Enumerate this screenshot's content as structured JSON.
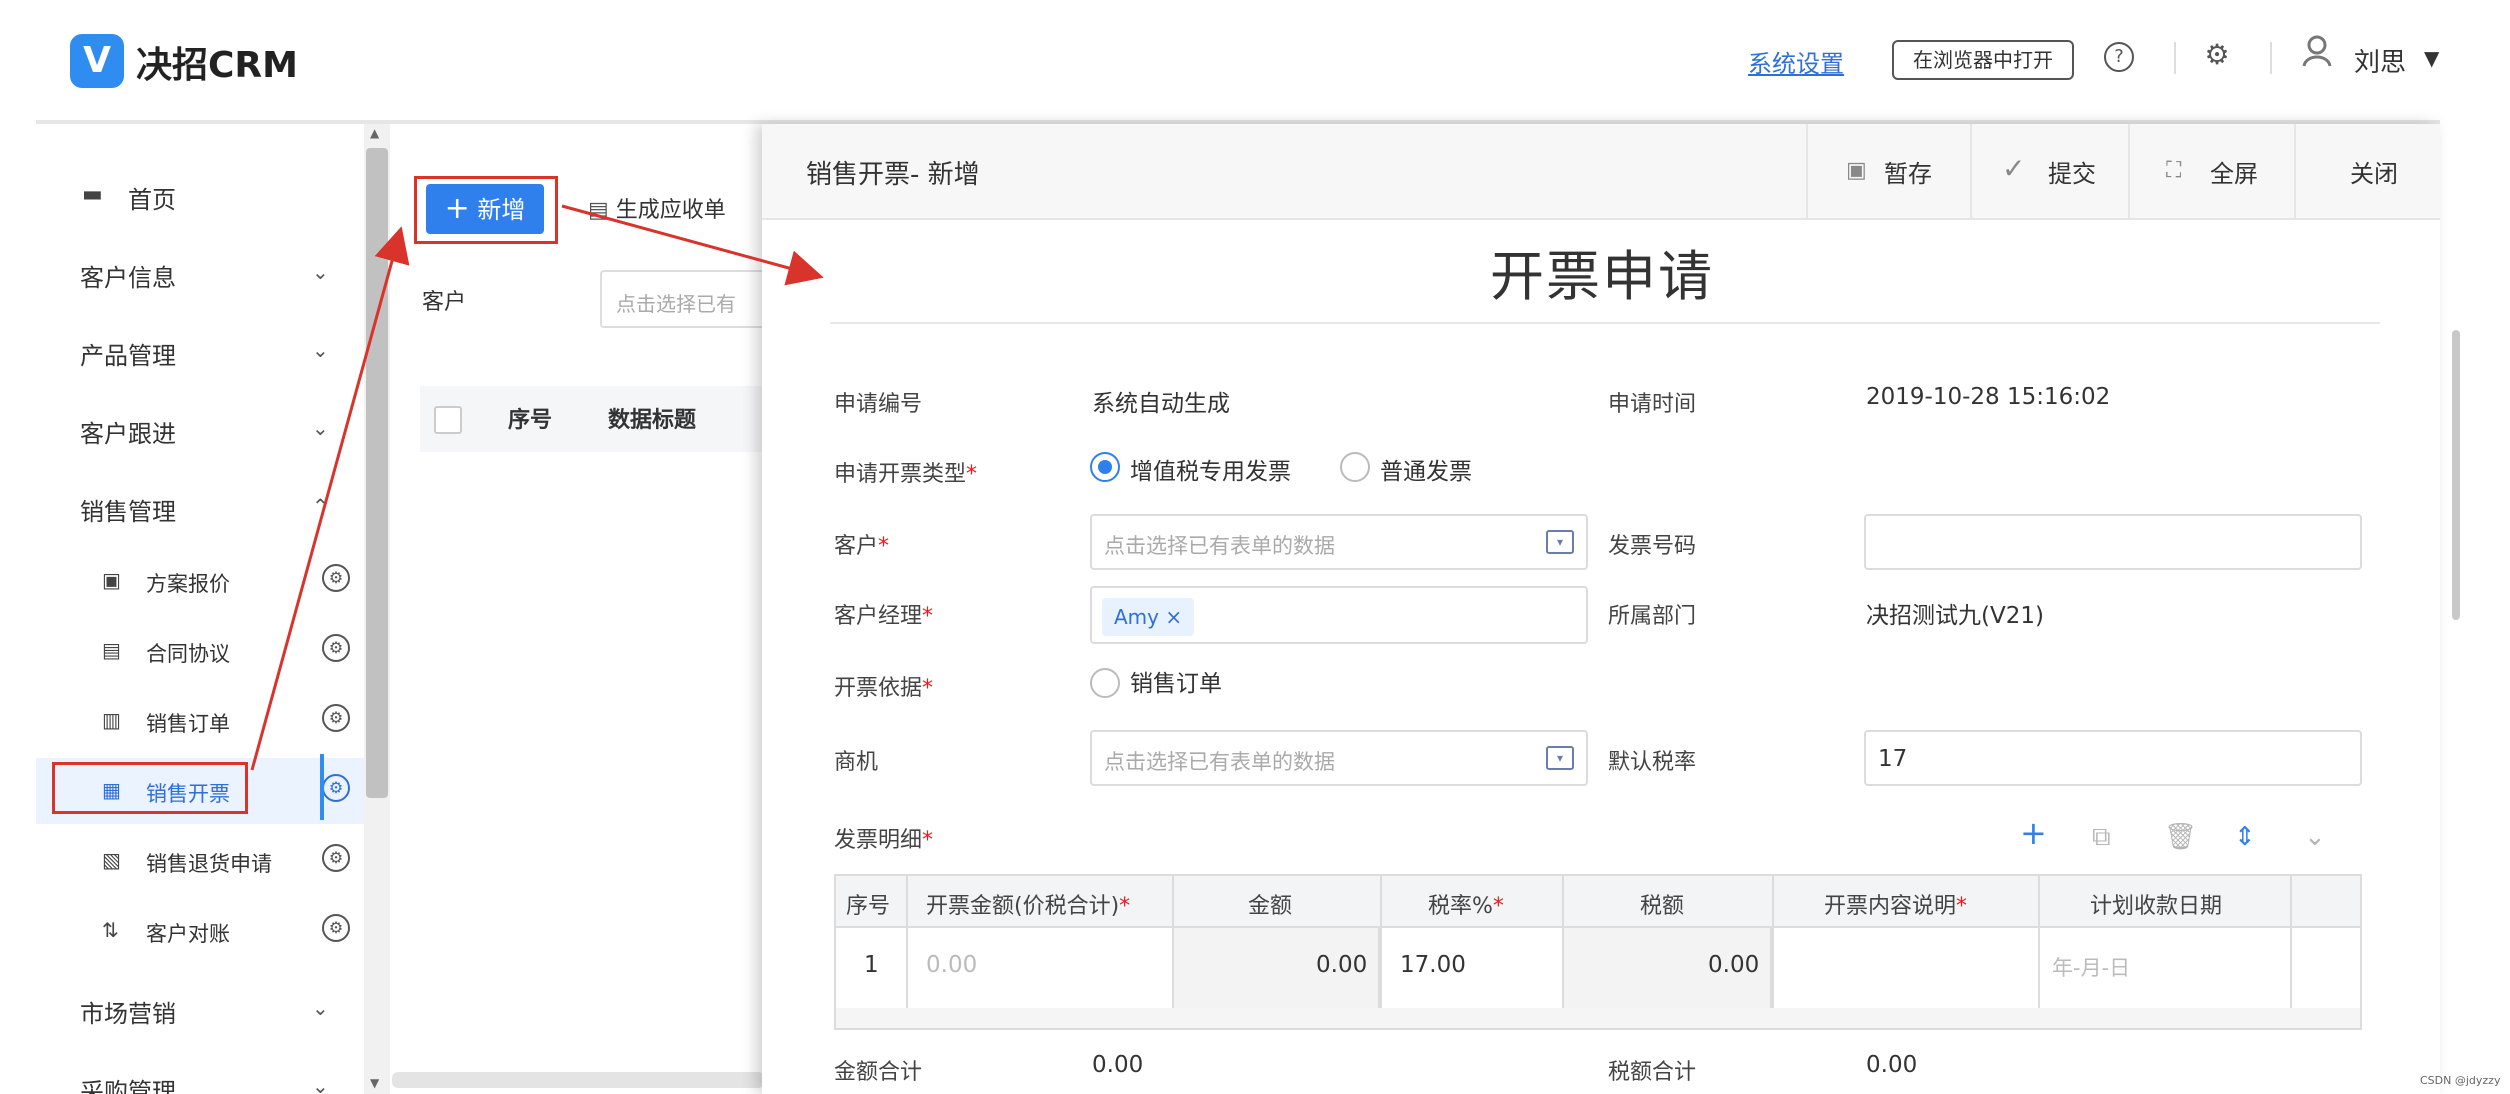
{
  "header": {
    "logo_mark": "V",
    "logo_text": "决招CRM",
    "settings_link": "系统设置",
    "open_in_browser": "在浏览器中打开",
    "help_icon": "?",
    "settings_icon": "⚙",
    "user_name": "刘思",
    "user_caret": "▼"
  },
  "sidebar": {
    "home": "首页",
    "items": [
      {
        "label": "客户信息"
      },
      {
        "label": "产品管理"
      },
      {
        "label": "客户跟进"
      },
      {
        "label": "销售管理"
      }
    ],
    "sales_sub": [
      {
        "label": "方案报价"
      },
      {
        "label": "合同协议"
      },
      {
        "label": "销售订单"
      },
      {
        "label": "销售开票"
      },
      {
        "label": "销售退货申请"
      },
      {
        "label": "客户对账"
      }
    ],
    "bottom_items": [
      {
        "label": "市场营销"
      },
      {
        "label": "采购管理"
      }
    ]
  },
  "list": {
    "add_button": "新增",
    "add_icon": "+",
    "generate_button": "生成应收单",
    "customer_label": "客户",
    "customer_placeholder": "点击选择已有",
    "columns": [
      "序号",
      "数据标题"
    ]
  },
  "dialog": {
    "title": "销售开票- 新增",
    "save": "暂存",
    "submit": "提交",
    "fullscreen": "全屏",
    "close": "关闭",
    "form_title": "开票申请",
    "fields": {
      "apply_no_label": "申请编号",
      "apply_no_value": "系统自动生成",
      "apply_time_label": "申请时间",
      "apply_time_value": "2019-10-28 15:16:02",
      "invoice_type_label": "申请开票类型",
      "invoice_type_opt1": "增值税专用发票",
      "invoice_type_opt2": "普通发票",
      "customer_label": "客户",
      "customer_placeholder": "点击选择已有表单的数据",
      "invoice_no_label": "发票号码",
      "invoice_no_value": "",
      "manager_label": "客户经理",
      "manager_tag": "Amy",
      "tag_close": "×",
      "dept_label": "所属部门",
      "dept_value": "决招测试九(V21)",
      "basis_label": "开票依据",
      "basis_opt": "销售订单",
      "opportunity_label": "商机",
      "opportunity_placeholder": "点击选择已有表单的数据",
      "tax_rate_label": "默认税率",
      "tax_rate_value": "17",
      "req_mark": "*"
    },
    "detail": {
      "title": "发票明细",
      "tools": [
        "+",
        "⧉",
        "🗑",
        "⇕",
        "⌄"
      ],
      "columns": [
        "序号",
        "开票金额(价税合计)",
        "金额",
        "税率%",
        "税额",
        "开票内容说明",
        "计划收款日期"
      ],
      "required_cols": [
        false,
        true,
        false,
        true,
        false,
        true,
        false
      ],
      "row": {
        "no": "1",
        "invoice_amount": "0.00",
        "amount": "0.00",
        "tax_rate": "17.00",
        "tax": "0.00",
        "desc": "",
        "plan_date": "年-月-日"
      }
    },
    "totals": {
      "amount_label": "金额合计",
      "amount_value": "0.00",
      "tax_label": "税额合计",
      "tax_value": "0.00"
    }
  },
  "watermark": "CSDN @jdyzzy",
  "colors": {
    "primary": "#2f80ed",
    "annotation_red": "#d9342b"
  }
}
